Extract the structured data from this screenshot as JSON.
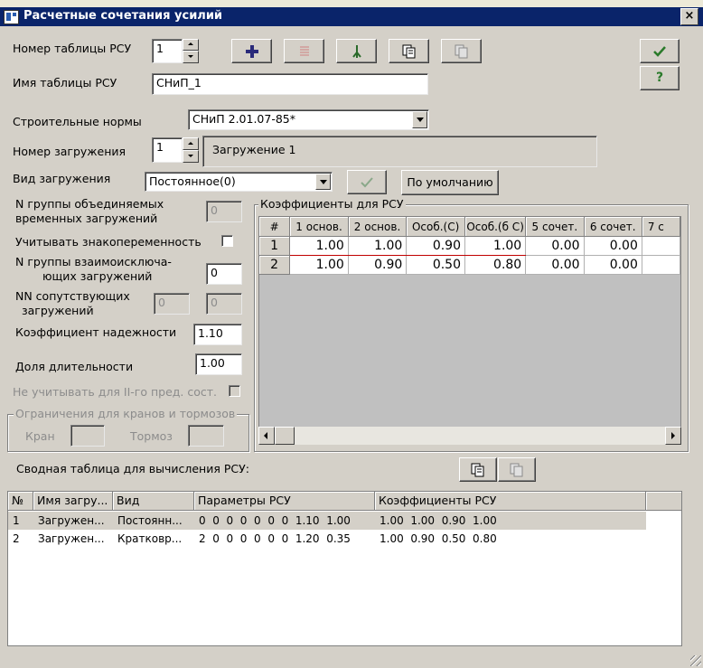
{
  "window": {
    "title": "Расчетные сочетания усилий",
    "close_label": "×"
  },
  "form": {
    "table_number_label": "Номер таблицы РСУ",
    "table_number_value": "1",
    "table_name_label": "Имя таблицы РСУ",
    "table_name_value": "СНиП_1",
    "norms_label": "Строительные нормы",
    "norms_value": "СНиП 2.01.07-85*",
    "load_number_label": "Номер загружения",
    "load_number_value": "1",
    "load_name_value": "Загружение 1",
    "load_type_label": "Вид загружения",
    "load_type_value": "Постоянное(0)",
    "default_button": "По умолчанию",
    "group_temp_label_1": "N группы объединяемых",
    "group_temp_label_2": "временных загружений",
    "group_temp_value": "0",
    "sign_label": "Учитывать знакопеременность",
    "mutex_label_1": "N группы взаимоисключа-",
    "mutex_label_2": "ющих загружений",
    "mutex_value": "0",
    "nn_label_1": "NN сопутствующих",
    "nn_label_2": "загружений",
    "nn_value_1": "0",
    "nn_value_2": "0",
    "reliability_label": "Коэффициент надежности",
    "reliability_value": "1.10",
    "duration_label": "Доля длительности",
    "duration_value": "1.00",
    "ignore_label": "Не учитывать для II-го пред. сост.",
    "cranes_group": "Ограничения для кранов и тормозов",
    "crane_label": "Кран",
    "brake_label": "Тормоз"
  },
  "coef_grid": {
    "title": "Коэффициенты для РСУ",
    "headers": [
      "#",
      "1 основ.",
      "2 основ.",
      "Особ.(С)",
      "Особ.(б С)",
      "5 сочет.",
      "6 сочет.",
      "7 с"
    ],
    "rows": [
      {
        "n": "1",
        "v": [
          "1.00",
          "1.00",
          "0.90",
          "1.00",
          "0.00",
          "0.00"
        ]
      },
      {
        "n": "2",
        "v": [
          "1.00",
          "0.90",
          "0.50",
          "0.80",
          "0.00",
          "0.00"
        ]
      }
    ]
  },
  "summary": {
    "label": "Сводная таблица для вычисления РСУ:",
    "headers": [
      "№",
      "Имя загру...",
      "Вид",
      "Параметры РСУ",
      "Коэффициенты РСУ"
    ],
    "rows": [
      {
        "n": "1",
        "name": "Загружен...",
        "type": "Постоянн...",
        "params": "0  0  0  0  0  0  0  1.10  1.00",
        "coefs": "1.00  1.00  0.90  1.00"
      },
      {
        "n": "2",
        "name": "Загружен...",
        "type": "Кратковр...",
        "params": "2  0  0  0  0  0  0  1.20  0.35",
        "coefs": "1.00  0.90  0.50  0.80"
      }
    ]
  },
  "colors": {
    "title_bar": "#0a246a",
    "dialog_bg": "#d4d0c8",
    "selected_row": "#d4d0c8"
  }
}
